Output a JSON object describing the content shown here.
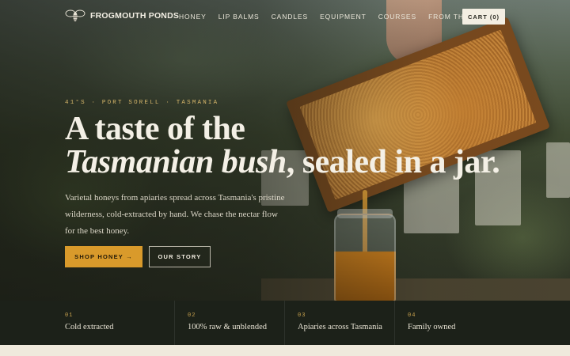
{
  "brand": {
    "name": "FROGMOUTH PONDS",
    "logo_icon": "bee-icon"
  },
  "nav": {
    "links": [
      "HONEY",
      "LIP BALMS",
      "CANDLES",
      "EQUIPMENT",
      "COURSES",
      "FROM THE APIARY"
    ],
    "cart_label": "CART (0)"
  },
  "hero": {
    "eyebrow": "41°S · PORT SORELL · TASMANIA",
    "headline_line1": "A taste of the",
    "headline_italic": "Tasmanian bush",
    "headline_rest": ", sealed in a jar.",
    "lede": "Varietal honeys from apiaries spread across Tasmania's pristine wilderness, cold-extracted by hand. We chase the nectar flow for the best honey.",
    "primary_cta": "SHOP HONEY →",
    "secondary_cta": "OUR STORY"
  },
  "features": [
    {
      "num": "01",
      "label": "Cold extracted"
    },
    {
      "num": "02",
      "label": "100% raw & unblended"
    },
    {
      "num": "03",
      "label": "Apiaries across Tasmania"
    },
    {
      "num": "04",
      "label": "Family owned"
    }
  ],
  "colors": {
    "accent": "#d99a2b",
    "dark_band": "#1c2119",
    "cream": "#efe9dc"
  }
}
